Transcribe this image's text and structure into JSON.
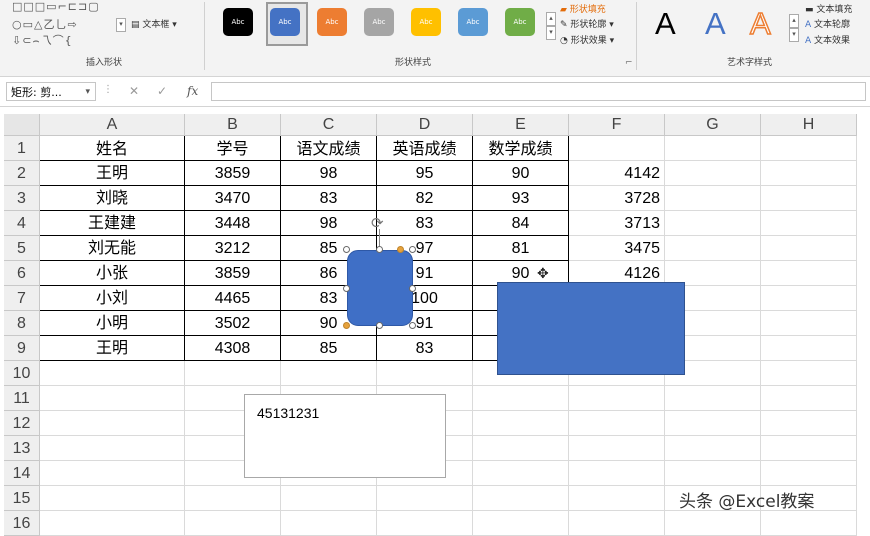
{
  "ribbon": {
    "shapes_row1": "□□□▭⌐⊏⊐▢",
    "shapes_row2": "○▭△乙乚⇨",
    "shapes_row3": "⇩⊂⌢乁⌒{",
    "edit_shape_label": "",
    "textbox_label": "文本框",
    "insert_shapes_label": "插入形状",
    "swatches": [
      {
        "text": "Abc",
        "bg": "#000000",
        "fg": "#ffffff"
      },
      {
        "text": "Abc",
        "bg": "#4472c4",
        "fg": "#ffffff"
      },
      {
        "text": "Abc",
        "bg": "#ed7d31",
        "fg": "#ffffff"
      },
      {
        "text": "Abc",
        "bg": "#a5a5a5",
        "fg": "#ffffff"
      },
      {
        "text": "Abc",
        "bg": "#ffc000",
        "fg": "#ffffff"
      },
      {
        "text": "Abc",
        "bg": "#5b9bd5",
        "fg": "#ffffff"
      },
      {
        "text": "Abc",
        "bg": "#70ad47",
        "fg": "#ffffff"
      }
    ],
    "shape_fill_label": "形状填充",
    "shape_outline_label": "形状轮廓",
    "shape_effects_label": "形状效果",
    "shape_styles_label": "形状样式",
    "wordart_letters": [
      "A",
      "A",
      "A"
    ],
    "text_fill_label": "文本填充",
    "text_outline_label": "文本轮廓",
    "text_effects_label": "文本效果",
    "wordart_styles_label": "艺术字样式"
  },
  "formula_bar": {
    "name_box": "矩形: 剪...",
    "cancel": "✕",
    "enter": "✓",
    "fx": "fx",
    "formula": ""
  },
  "columns": [
    "A",
    "B",
    "C",
    "D",
    "E",
    "F",
    "G",
    "H"
  ],
  "rows": [
    "1",
    "2",
    "3",
    "4",
    "5",
    "6",
    "7",
    "8",
    "9",
    "10",
    "11",
    "12",
    "13",
    "14",
    "15",
    "16"
  ],
  "table": {
    "headers": [
      "姓名",
      "学号",
      "语文成绩",
      "英语成绩",
      "数学成绩"
    ],
    "data": [
      [
        "王明",
        "3859",
        "98",
        "95",
        "90",
        "4142"
      ],
      [
        "刘晓",
        "3470",
        "83",
        "82",
        "93",
        "3728"
      ],
      [
        "王建建",
        "3448",
        "98",
        "83",
        "84",
        "3713"
      ],
      [
        "刘无能",
        "3212",
        "85",
        "97",
        "81",
        "3475"
      ],
      [
        "小张",
        "3859",
        "86",
        "91",
        "90",
        "4126"
      ],
      [
        "小刘",
        "4465",
        "83",
        "100",
        "",
        ""
      ],
      [
        "小明",
        "3502",
        "90",
        "91",
        "",
        ""
      ],
      [
        "王明",
        "4308",
        "85",
        "83",
        "",
        ""
      ]
    ]
  },
  "textbox_value": "45131231",
  "watermark": "头条 @Excel教案"
}
